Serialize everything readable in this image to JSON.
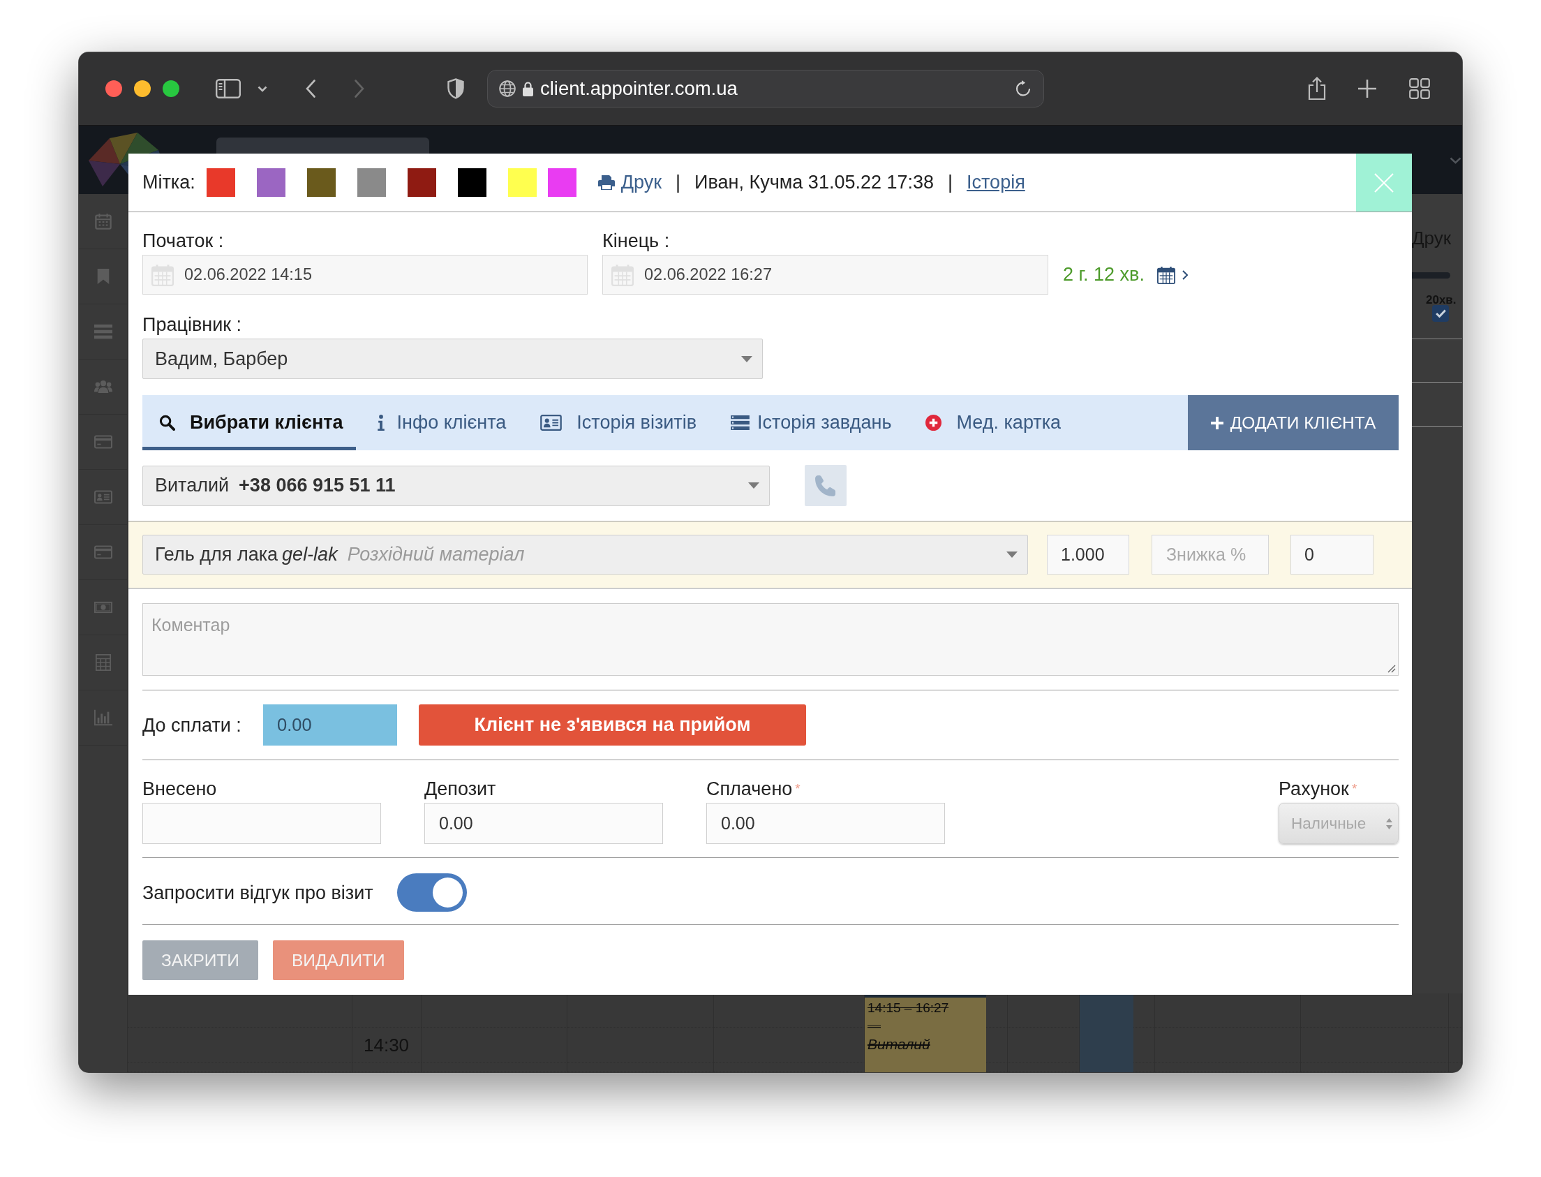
{
  "browser": {
    "url": "client.appointer.com.ua"
  },
  "page": {
    "side_text": "Друк",
    "duration_badge": "20хв.",
    "checkbox": {
      "checked": true
    },
    "time_label": "14:30",
    "appointment": {
      "time": "14:15 – 16:27",
      "dash": "—",
      "client": "Виталий"
    }
  },
  "modal": {
    "header": {
      "label": "Мітка:",
      "swatches": [
        {
          "color": "#e8392a"
        },
        {
          "color": "#9b66c2"
        },
        {
          "color": "#6a5a1c"
        },
        {
          "color": "#8a8a8a"
        },
        {
          "color": "#8f1b12"
        },
        {
          "color": "#000000"
        },
        {
          "color": "#ffff4f"
        },
        {
          "color": "#e93cf2"
        }
      ],
      "print_link": "Друк",
      "separator_1": "|",
      "author_stamp": "Иван, Кучма 31.05.22 17:38",
      "separator_2": "|",
      "history_link": "Історія"
    },
    "start": {
      "label": "Початок :",
      "value": "02.06.2022 14:15"
    },
    "end": {
      "label": "Кінець :",
      "value": "02.06.2022 16:27"
    },
    "duration": "2 г. 12 хв.",
    "employee": {
      "label": "Працівник :",
      "value": "Вадим, Барбер"
    },
    "tabs": [
      {
        "label": "Вибрати клієнта",
        "selected": true
      },
      {
        "label": "Інфо клієнта",
        "selected": false
      },
      {
        "label": "Історія візитів",
        "selected": false
      },
      {
        "label": "Історія завдань",
        "selected": false
      },
      {
        "label": "Мед. картка",
        "selected": false
      }
    ],
    "add_client_button": "ДОДАТИ КЛІЄНТА",
    "client": {
      "name": "Виталий",
      "phone": "+38 066 915 51 11"
    },
    "product": {
      "name": "Гель для лака",
      "code": "gel-lak",
      "category": "Розхідний матеріал",
      "quantity": "1.000",
      "discount_placeholder": "Знижка %",
      "discount_value": "0"
    },
    "comment": {
      "placeholder": "Коментар"
    },
    "amount_due": {
      "label": "До сплати :",
      "value": "0.00"
    },
    "no_show_button": "Клієнт не з'явився на прийом",
    "payments": [
      {
        "kind": "input",
        "label": "Внесено",
        "disabled": false
      },
      {
        "kind": "input",
        "label": "Депозит",
        "value": "0.00",
        "disabled": false
      },
      {
        "kind": "input",
        "label": "Сплачено",
        "required_mark": "*",
        "value": "0.00",
        "disabled": false
      },
      {
        "kind": "select",
        "label": "Рахунок",
        "required_mark": "*",
        "value": "Наличные",
        "disabled": true
      }
    ],
    "feedback": {
      "label": "Запросити відгук про візит",
      "on": true
    },
    "buttons": [
      {
        "kind": "close",
        "label": "ЗАКРИТИ"
      },
      {
        "kind": "delete",
        "label": "ВИДАЛИТИ"
      }
    ]
  }
}
